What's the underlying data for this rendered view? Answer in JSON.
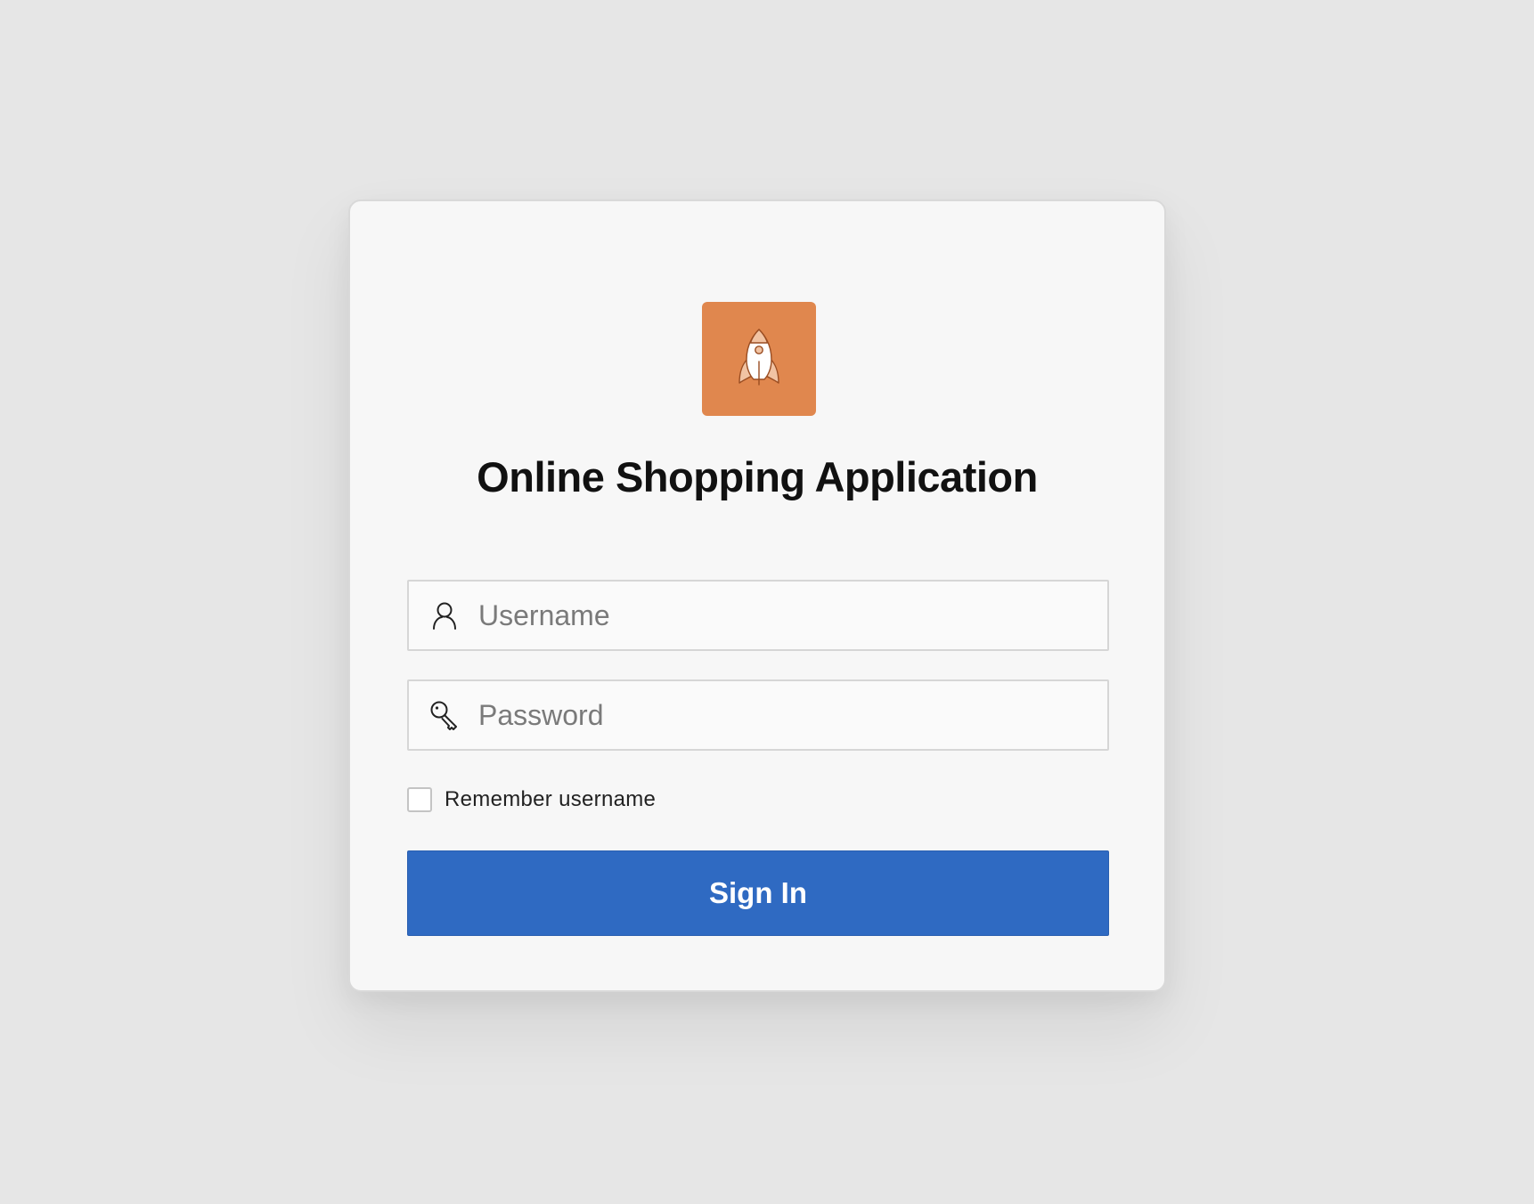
{
  "app": {
    "title": "Online Shopping Application",
    "logo_icon": "rocket-icon",
    "logo_color": "#e0874e"
  },
  "form": {
    "username": {
      "placeholder": "Username",
      "value": "",
      "icon": "user-icon"
    },
    "password": {
      "placeholder": "Password",
      "value": "",
      "icon": "key-icon"
    },
    "remember": {
      "label": "Remember username",
      "checked": false
    },
    "submit": {
      "label": "Sign In",
      "color": "#2f6ac2"
    }
  }
}
